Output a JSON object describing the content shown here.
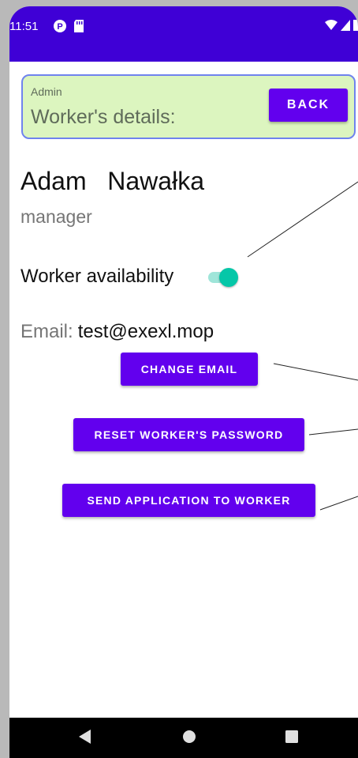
{
  "status_bar": {
    "time": "11:51",
    "left_icons": [
      "p-notification-icon",
      "sd-card-icon"
    ],
    "right_icons": [
      "wifi-icon",
      "cell-signal-icon",
      "battery-icon"
    ]
  },
  "header": {
    "role_label": "Admin",
    "title": "Worker's details:",
    "back_label": "BACK"
  },
  "worker": {
    "first_name": "Adam",
    "last_name": "Nawałka",
    "role": "manager",
    "availability_label": "Worker availability",
    "availability": true,
    "email_label": "Email:",
    "email": "test@exexl.mop"
  },
  "actions": {
    "change_email": "CHANGE EMAIL",
    "reset_password": "RESET WORKER'S PASSWORD",
    "send_application": "SEND APPLICATION TO WORKER"
  },
  "nav_bar": {
    "buttons": [
      "back-triangle-icon",
      "home-circle-icon",
      "recents-square-icon"
    ]
  },
  "colors": {
    "status_bar": "#3f00d6",
    "accent": "#6200ee",
    "header_bg": "#dcf5bf",
    "header_border": "#6f83ee",
    "toggle_on": "#05c7a8"
  }
}
